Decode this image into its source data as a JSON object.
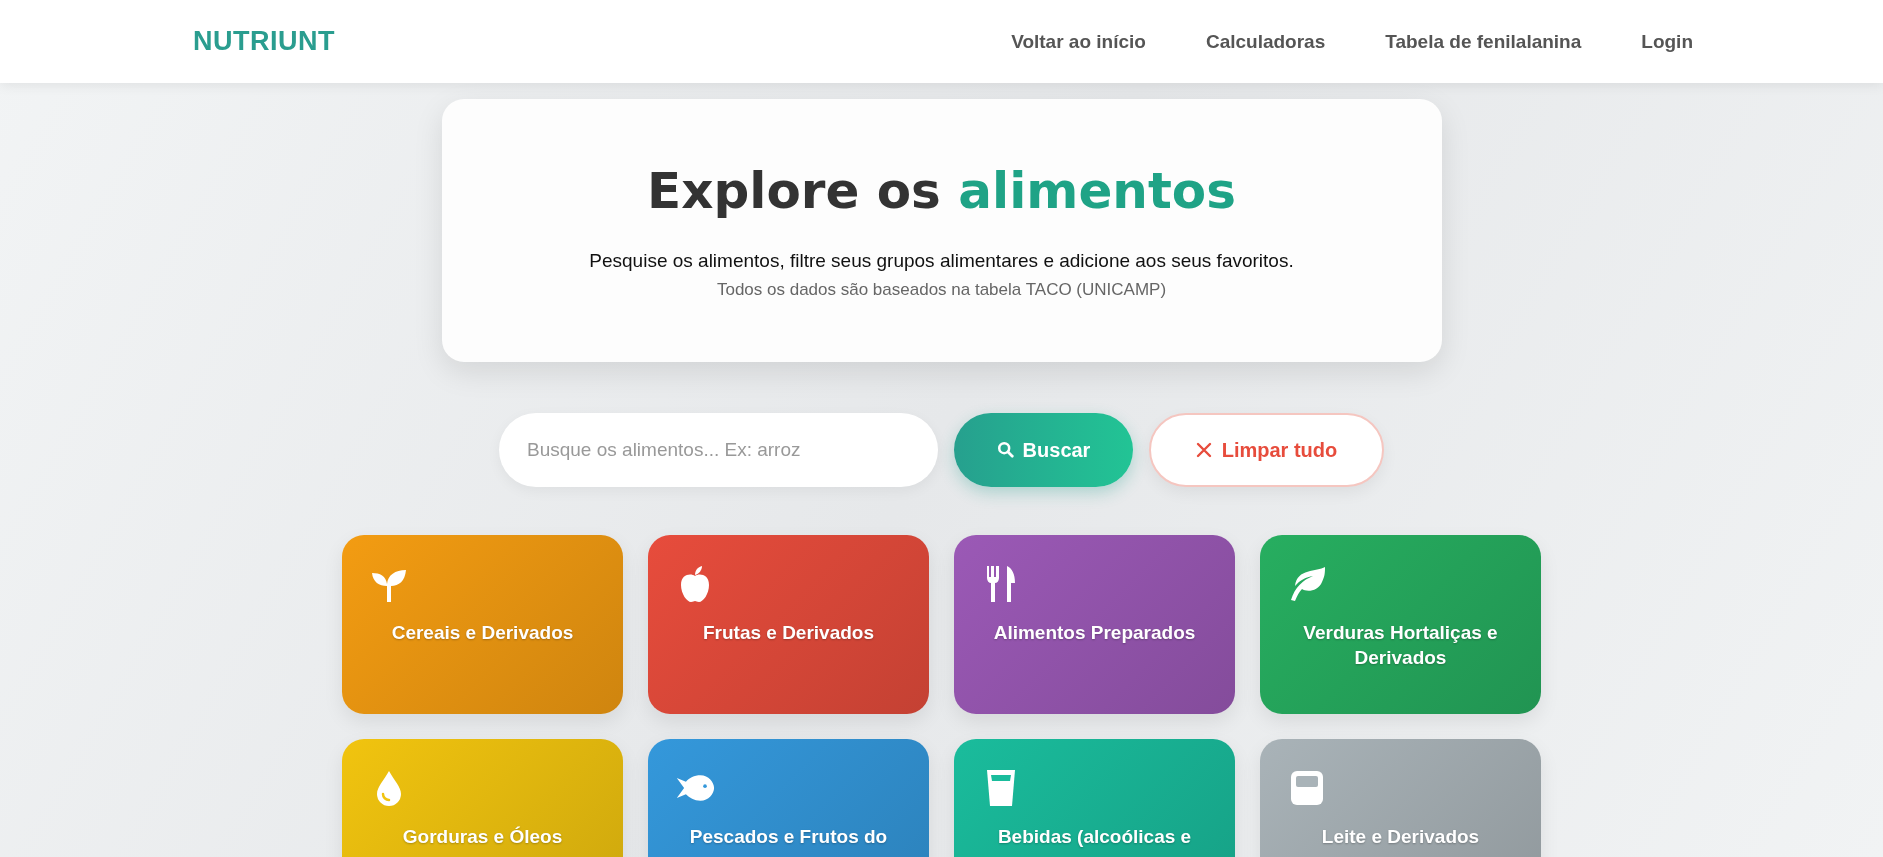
{
  "header": {
    "logo": "NUTRIUNT",
    "nav": [
      "Voltar ao início",
      "Calculadoras",
      "Tabela de fenilalanina",
      "Login"
    ]
  },
  "hero": {
    "title": "Explore os",
    "title_highlight": "alimentos",
    "description": "Pesquise os alimentos, filtre seus grupos alimentares e adicione aos seus favoritos.",
    "note": "Todos os dados são baseados na tabela TACO (UNICAMP)"
  },
  "search": {
    "placeholder": "Busque os alimentos... Ex: arroz",
    "search_button": "Buscar",
    "clear_button": "Limpar tudo"
  },
  "categories": [
    {
      "label": "Cereais e Derivados",
      "kind": "sprout",
      "color": "#f39c12"
    },
    {
      "label": "Frutas e Derivados",
      "kind": "apple",
      "color": "#e74c3c"
    },
    {
      "label": "Alimentos Preparados",
      "kind": "utensils",
      "color": "#9b59b6"
    },
    {
      "label": "Verduras Hortaliças e Derivados",
      "kind": "leaf",
      "color": "#27ae60"
    },
    {
      "label": "Gorduras e Óleos",
      "kind": "drop",
      "color": "#f1c40f"
    },
    {
      "label": "Pescados e Frutos do",
      "kind": "fish",
      "color": "#3498db"
    },
    {
      "label": "Bebidas (alcoólicas e",
      "kind": "glass",
      "color": "#1abc9c"
    },
    {
      "label": "Leite e Derivados",
      "kind": "jar",
      "color": "#a9b3b8"
    }
  ]
}
